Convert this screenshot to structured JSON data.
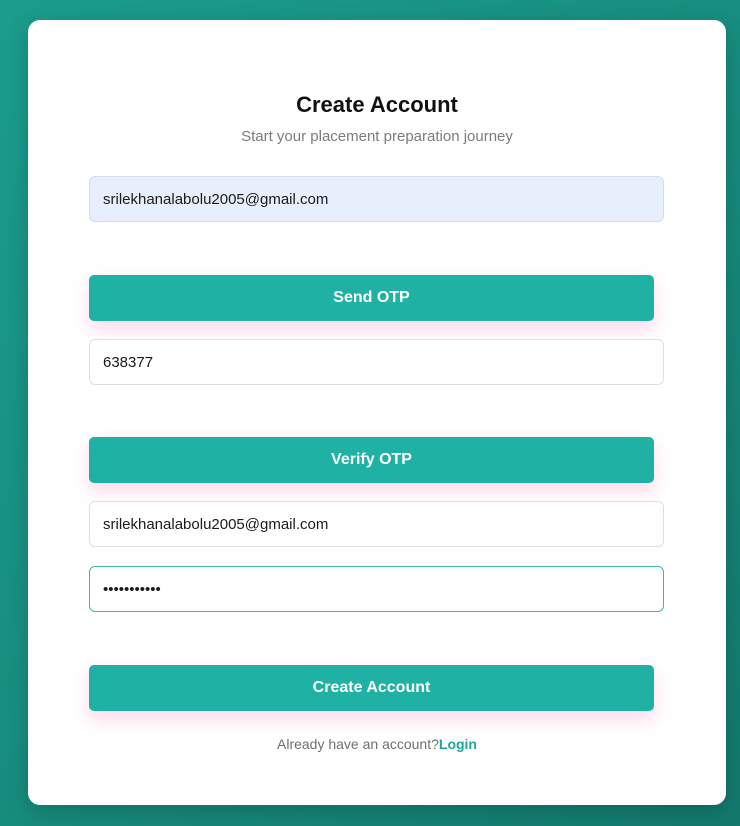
{
  "header": {
    "title": "Create Account",
    "subtitle": "Start your placement preparation journey"
  },
  "form": {
    "email_otp_value": "srilekhanalabolu2005@gmail.com",
    "send_otp_label": "Send OTP",
    "otp_value": "638377",
    "verify_otp_label": "Verify OTP",
    "email_value": "srilekhanalabolu2005@gmail.com",
    "password_value": "•••••••••••",
    "create_account_label": "Create Account"
  },
  "footer": {
    "prompt": "Already have an account?",
    "login_link": "Login"
  },
  "colors": {
    "accent": "#1fb1a3",
    "background": "#1b9c8c",
    "link": "#1fa696"
  }
}
